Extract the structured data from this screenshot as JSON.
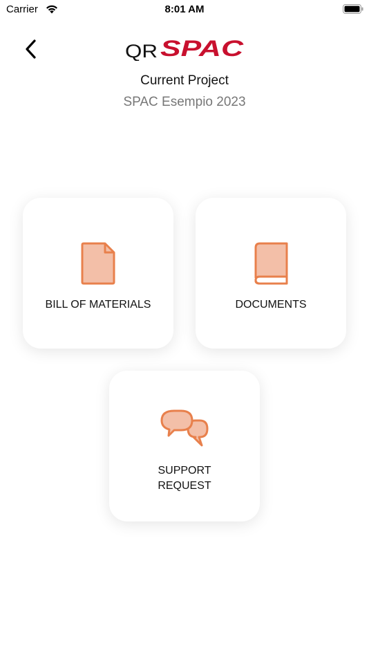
{
  "status_bar": {
    "carrier": "Carrier",
    "time": "8:01 AM"
  },
  "header": {
    "logo": {
      "prefix": "QR",
      "brand": "SPAC"
    },
    "project_heading": "Current Project",
    "project_name": "SPAC Esempio 2023"
  },
  "menu": {
    "bill_of_materials": {
      "label": "BILL OF MATERIALS",
      "icon": "document-icon"
    },
    "documents": {
      "label": "DOCUMENTS",
      "icon": "book-icon"
    },
    "support_request": {
      "label_line1": "SUPPORT",
      "label_line2": "REQUEST",
      "icon": "chat-bubbles-icon"
    }
  },
  "colors": {
    "accent_stroke": "#E8804C",
    "accent_fill": "#F3BFA8",
    "brand_red": "#C8102E"
  }
}
